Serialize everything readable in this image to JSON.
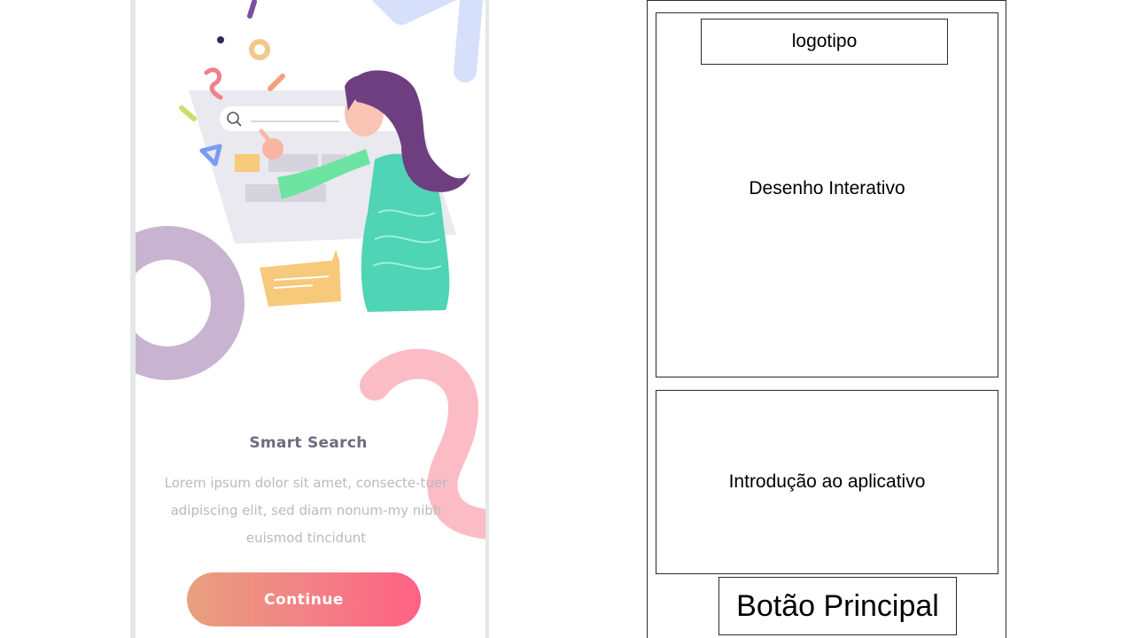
{
  "phone_screen": {
    "title": "Smart Search",
    "body_text": "Lorem ipsum dolor sit amet, consecte-tuer adipiscing elit, sed diam nonum-my nibh euismod tincidunt",
    "continue_label": "Continue",
    "colors": {
      "button_gradient_start": "#e8a07e",
      "button_gradient_end": "#ff6184",
      "title": "#6b6e7f",
      "body": "#b9b9c0"
    }
  },
  "wireframe": {
    "logo_label": "logotipo",
    "drawing_label": "Desenho Interativo",
    "intro_label": "Introdução ao aplicativo",
    "main_button_label": "Botão Principal"
  }
}
